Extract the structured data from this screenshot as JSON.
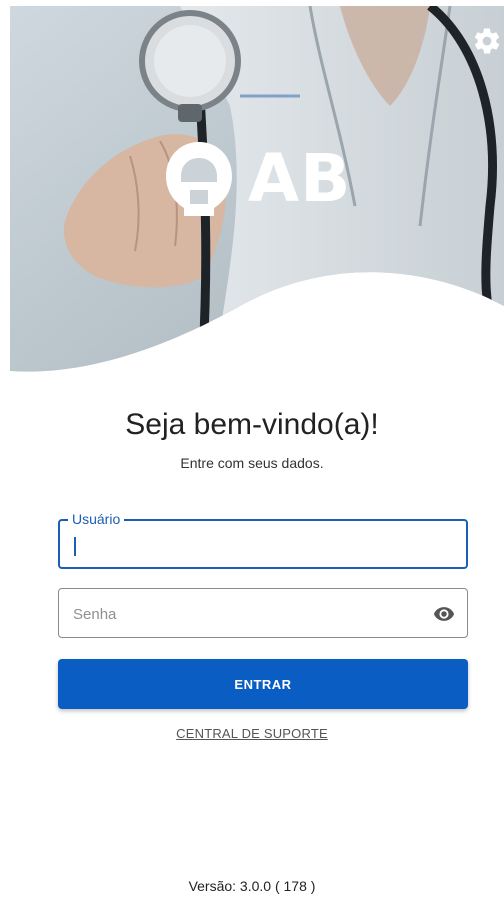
{
  "header": {
    "logo_text": "AB",
    "settings_icon": "gear-icon"
  },
  "welcome": {
    "title": "Seja bem-vindo(a)!",
    "subtitle": "Entre com seus dados."
  },
  "form": {
    "username_label": "Usuário",
    "username_value": "",
    "password_placeholder": "Senha",
    "password_value": "",
    "password_toggle_icon": "eye-icon",
    "submit_label": "ENTRAR",
    "support_link": "CENTRAL DE SUPORTE"
  },
  "footer": {
    "version": "Versão: 3.0.0 ( 178 )"
  },
  "colors": {
    "primary": "#0a5dc2",
    "focus_border": "#1a5fb4",
    "text": "#222222"
  }
}
